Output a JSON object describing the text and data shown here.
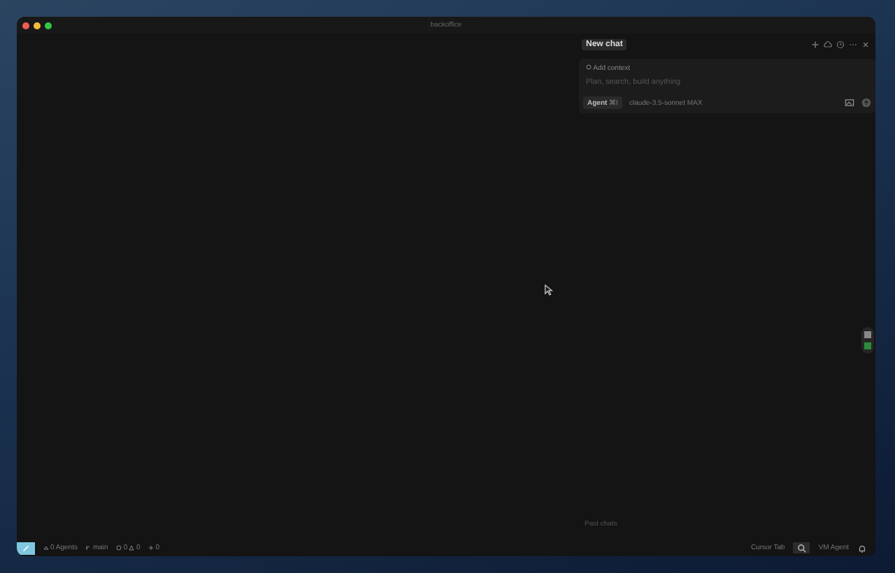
{
  "window": {
    "title": "backoffice"
  },
  "chat": {
    "title": "New chat",
    "add_context": "Add context",
    "placeholder": "Plan, search, build anything",
    "mode": "Agent",
    "mode_shortcut": "⌘I",
    "model": "claude-3.5-sonnet MAX",
    "past_chats": "Past chats"
  },
  "status_bar": {
    "agents": "0 Agents",
    "branch": "main",
    "errors": "0",
    "warnings": "0",
    "ports": "0",
    "cursor_tab": "Cursor Tab",
    "vm_agent": "VM Agent"
  }
}
